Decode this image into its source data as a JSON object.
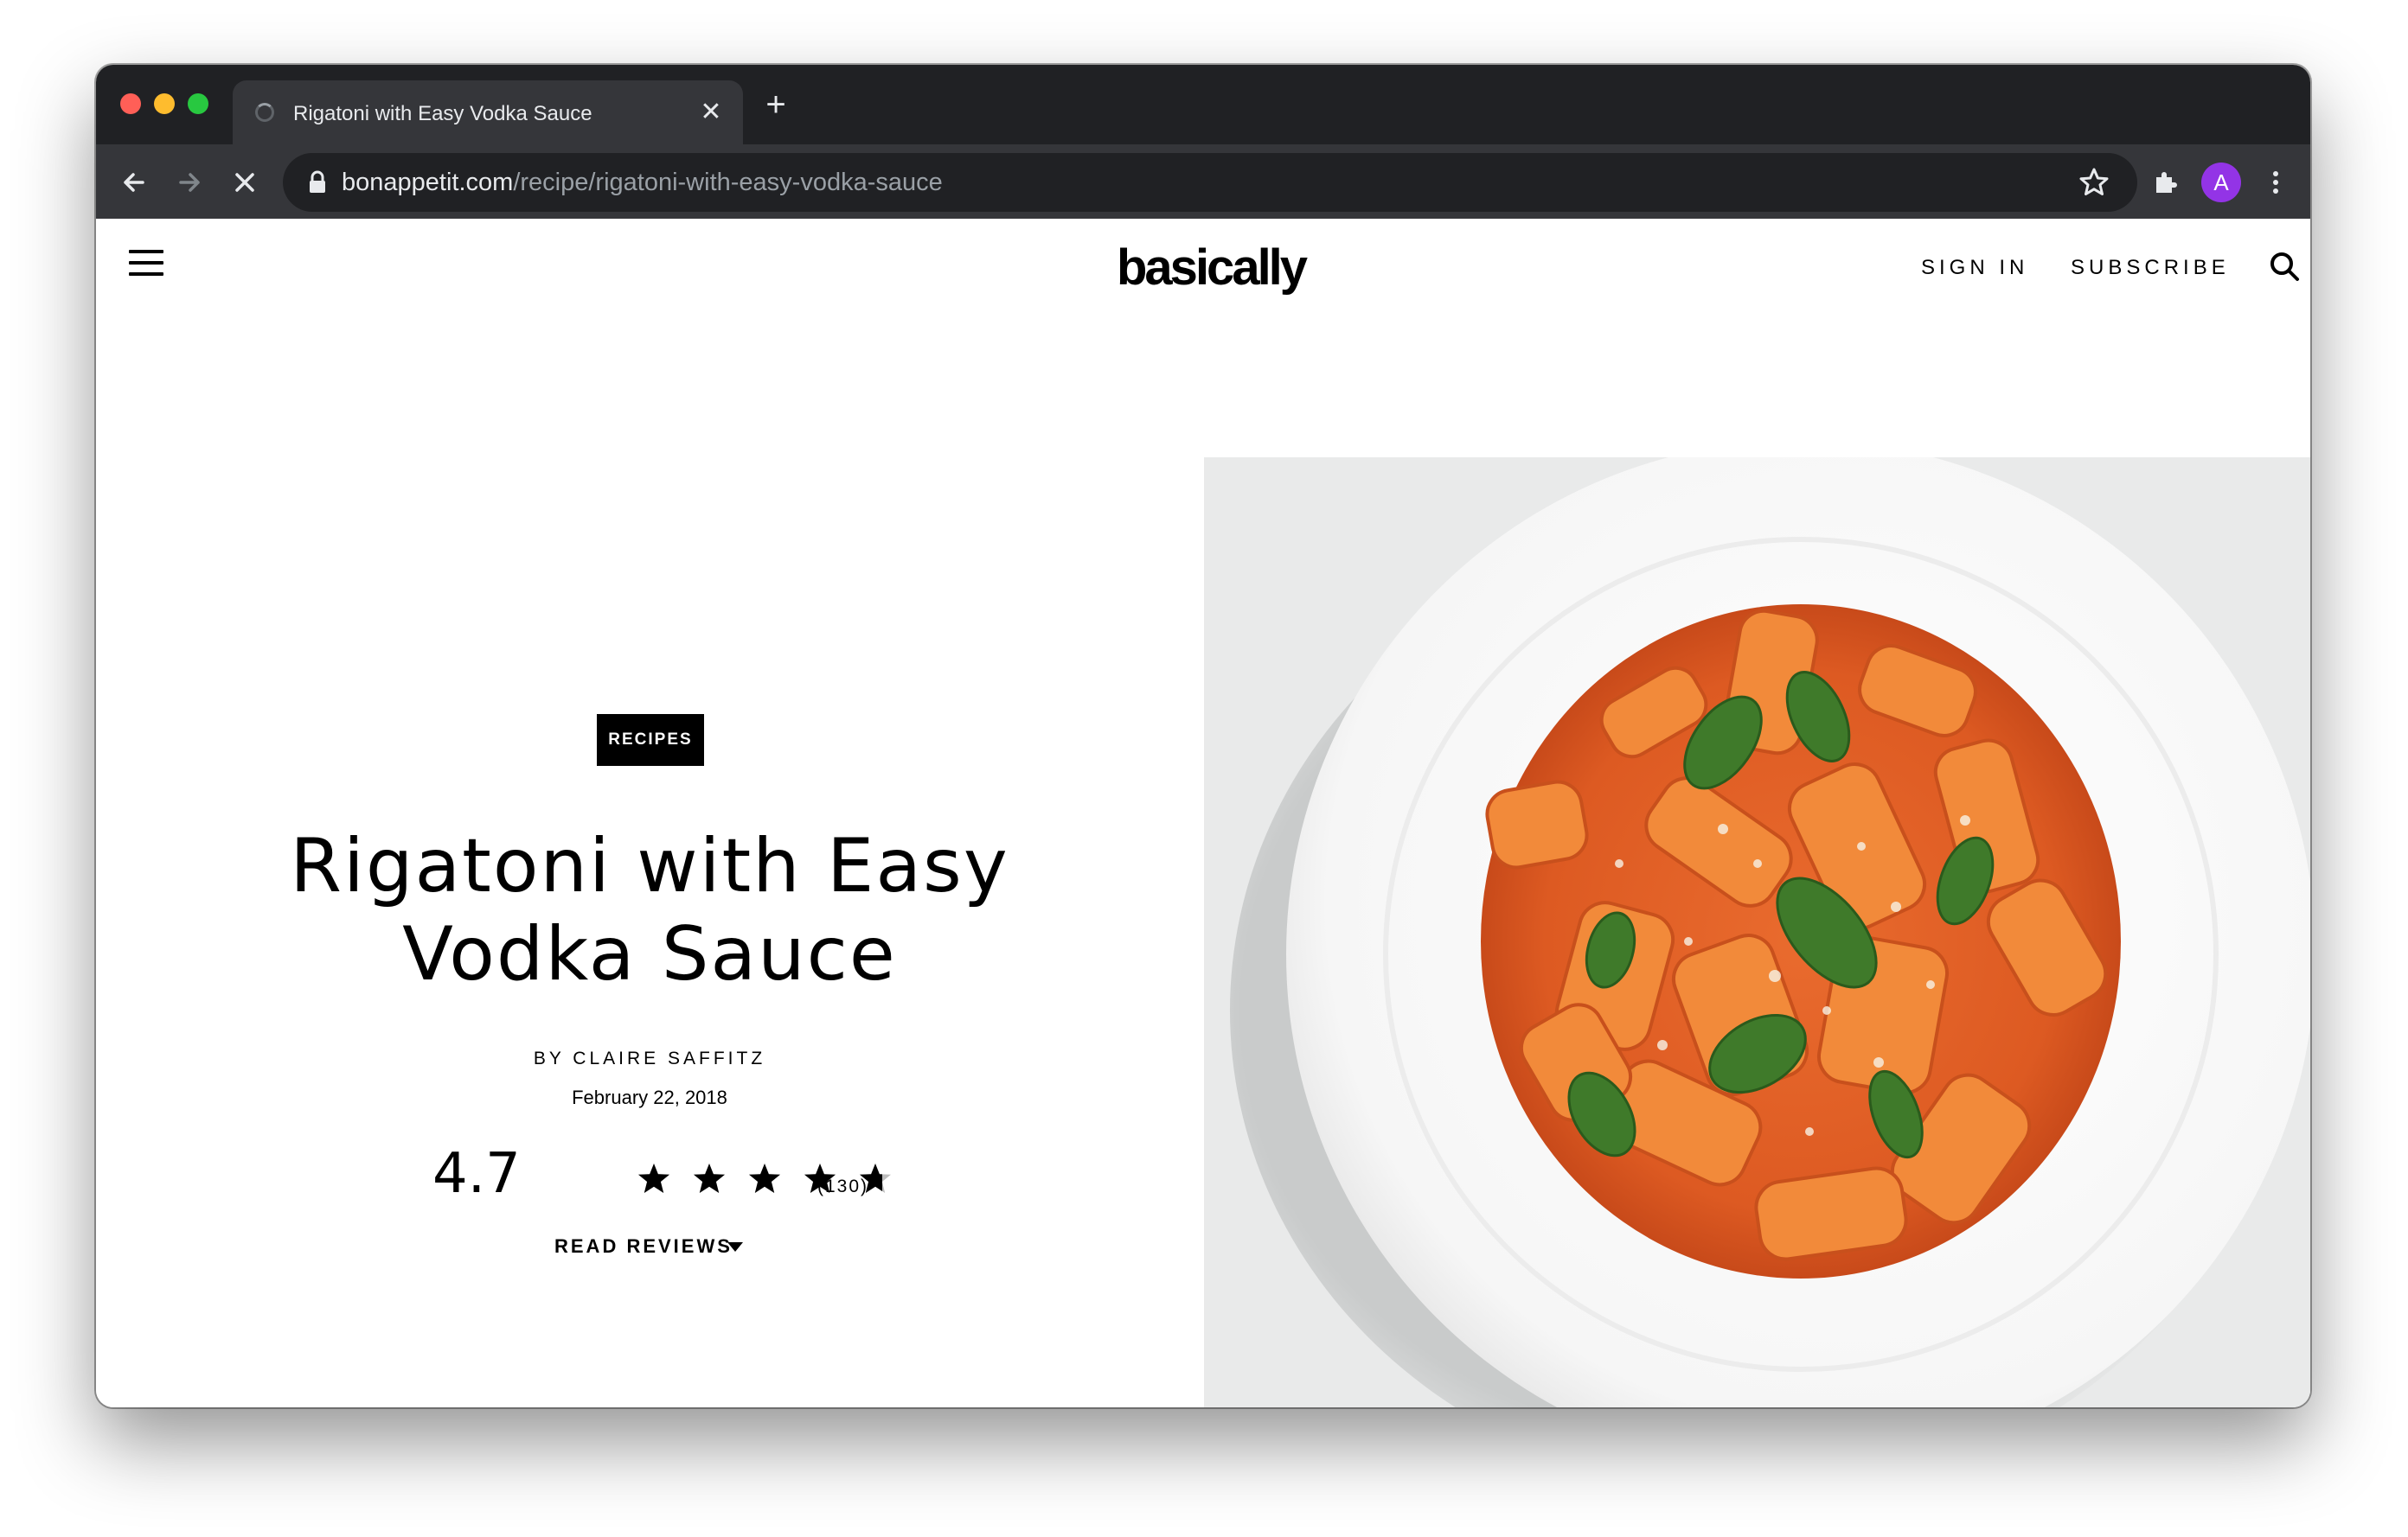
{
  "browser": {
    "tab": {
      "title": "Rigatoni with Easy Vodka Sauce"
    },
    "new_tab_symbol": "+",
    "close_symbol": "✕",
    "url": {
      "domain": "bonappetit.com",
      "path": "/recipe/rigatoni-with-easy-vodka-sauce"
    },
    "profile_initial": "A",
    "profile_color": "#9334e6"
  },
  "site": {
    "logo": "basically",
    "nav": {
      "sign_in": "SIGN IN",
      "subscribe": "SUBSCRIBE"
    }
  },
  "recipe": {
    "badge": "RECIPES",
    "title_line1": "Rigatoni with Easy",
    "title_line2": "Vodka Sauce",
    "byline": "BY CLAIRE SAFFITZ",
    "date": "February 22, 2018",
    "rating": {
      "value": "4.7",
      "stars_out_of_5": 4.7,
      "count": "(130)"
    },
    "read_reviews": "READ REVIEWS"
  },
  "icons": {
    "back": "back-arrow-icon",
    "forward": "forward-arrow-icon",
    "stop": "stop-loading-icon",
    "lock": "lock-icon",
    "bookmark": "bookmark-star-icon",
    "extensions": "puzzle-icon",
    "menu": "kebab-menu-icon",
    "site_menu": "hamburger-icon",
    "search": "search-icon"
  },
  "colors": {
    "badge_bg": "#000000",
    "browser_chrome": "#202124",
    "toolbar": "#35363a"
  }
}
